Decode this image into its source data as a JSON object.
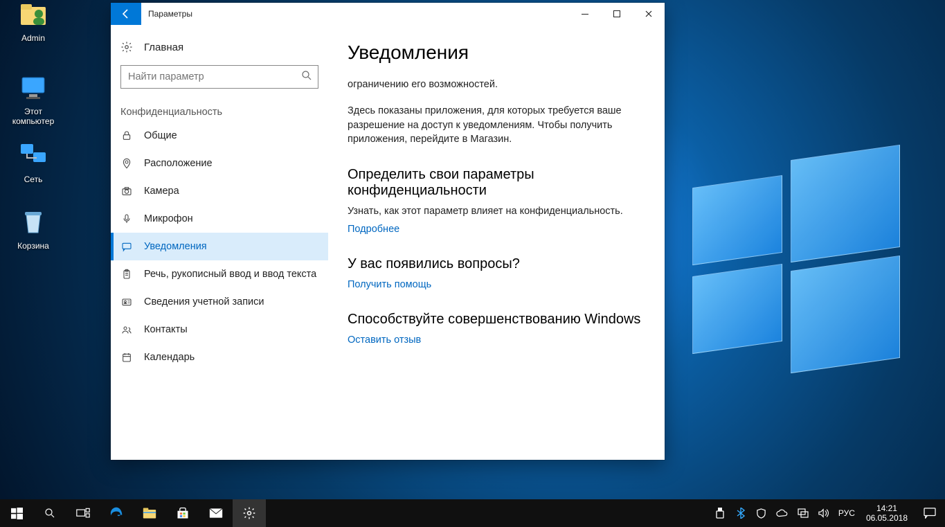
{
  "desktop": {
    "icons": {
      "admin": "Admin",
      "pc": "Этот компьютер",
      "network": "Сеть",
      "bin": "Корзина"
    }
  },
  "window": {
    "title": "Параметры",
    "home": "Главная",
    "search_placeholder": "Найти параметр",
    "section": "Конфиденциальность",
    "nav": {
      "general": "Общие",
      "location": "Расположение",
      "camera": "Камера",
      "microphone": "Микрофон",
      "notifications": "Уведомления",
      "speech": "Речь, рукописный ввод и ввод текста",
      "account": "Сведения учетной записи",
      "contacts": "Контакты",
      "calendar": "Календарь"
    }
  },
  "content": {
    "heading": "Уведомления",
    "trunc": "ограничению его возможностей.",
    "body2": "Здесь показаны приложения, для которых требуется ваше разрешение на доступ к уведомлениям. Чтобы получить приложения, перейдите в Магазин.",
    "h2a": "Определить свои параметры конфиденциальности",
    "p2a": "Узнать, как этот параметр влияет на конфиденциальность.",
    "link_a": "Подробнее",
    "h2b": "У вас появились вопросы?",
    "link_b": "Получить помощь",
    "h2c": "Способствуйте совершенствованию Windows",
    "link_c": "Оставить отзыв"
  },
  "taskbar": {
    "lang": "РУС",
    "time": "14:21",
    "date": "06.05.2018"
  }
}
